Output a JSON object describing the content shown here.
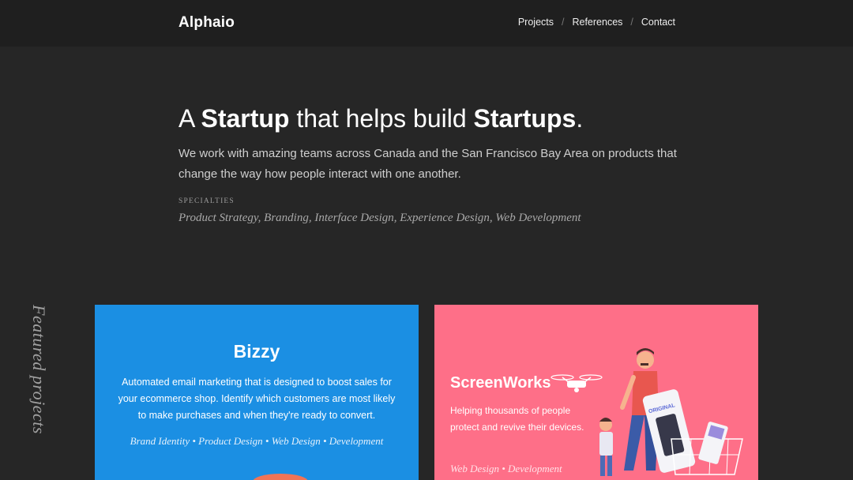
{
  "header": {
    "logo": "Alphaio",
    "nav": [
      {
        "label": "Projects"
      },
      {
        "label": "References"
      },
      {
        "label": "Contact"
      }
    ],
    "separator": "/"
  },
  "hero": {
    "headline_parts": [
      "A ",
      "Startup",
      " that helps build ",
      "Startups",
      "."
    ],
    "intro": "We work with amazing teams across Canada and the San Francisco Bay Area on products that change the way how people interact with one another.",
    "specialties_label": "SPECIALTIES",
    "specialties": "Product Strategy, Branding, Interface Design, Experience Design, Web Development"
  },
  "featured_label": "Featured projects",
  "projects": [
    {
      "name": "Bizzy",
      "description": "Automated email marketing that is designed to boost sales for your ecommerce shop. Identify which customers are most likely to make purchases and when they're ready to convert.",
      "tags": "Brand Identity • Product Design • Web Design • Development",
      "color": "#1b8fe3"
    },
    {
      "name": "ScreenWorks",
      "description": "Helping thousands of people protect and revive their devices.",
      "tags": "Web Design • Development",
      "color": "#fe6f88",
      "illustration_badge": "ORIGINAL"
    }
  ]
}
